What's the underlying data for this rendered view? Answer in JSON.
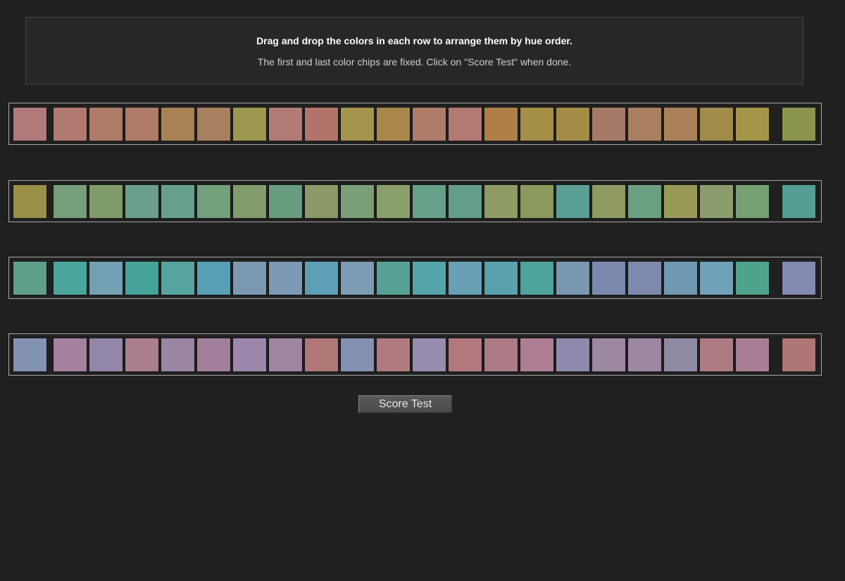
{
  "instructions": {
    "title": "Drag and drop the colors in each row to arrange them by hue order.",
    "subtitle": "The first and last color chips are fixed. Click on \"Score Test\" when done."
  },
  "score_button_label": "Score Test",
  "rows": [
    {
      "fixed_start": "#b17a7a",
      "movable": [
        "#b17a70",
        "#ae7b66",
        "#ae7c66",
        "#a98253",
        "#a8805f",
        "#9e974f",
        "#b17a75",
        "#b2746a",
        "#a4954d",
        "#a9874a",
        "#ae7c68",
        "#b17a73",
        "#ae8047",
        "#a38f46",
        "#a58c46",
        "#a67a6b",
        "#aa7f60",
        "#aa805a",
        "#a18b4a",
        "#a49649"
      ],
      "fixed_end": "#8b944c"
    },
    {
      "fixed_start": "#998f47",
      "movable": [
        "#769e79",
        "#7f9b6a",
        "#6aa08b",
        "#66a08b",
        "#71a07b",
        "#819b6a",
        "#679d7e",
        "#8a9966",
        "#7a9f77",
        "#8a9f6a",
        "#65a089",
        "#639e89",
        "#8e9b64",
        "#8b9a5c",
        "#5a9f94",
        "#8e9a62",
        "#6a9f82",
        "#999a57",
        "#8d9c6c",
        "#769f72"
      ],
      "fixed_end": "#559e93"
    },
    {
      "fixed_start": "#5e9f8c",
      "movable": [
        "#4aa59d",
        "#74a0b4",
        "#46a39a",
        "#56a49f",
        "#57a0b5",
        "#7b99b2",
        "#7c9ab6",
        "#5e9fb5",
        "#7b9cb3",
        "#55a295",
        "#55a4aa",
        "#66a0b2",
        "#5aa1ae",
        "#4ea39c",
        "#7997b1",
        "#7a89ad",
        "#7f89ab",
        "#6f99b2",
        "#6fa1b8",
        "#4ea38d"
      ],
      "fixed_end": "#848ab1"
    },
    {
      "fixed_start": "#8492b4",
      "movable": [
        "#a6819f",
        "#9387a9",
        "#ab7e8e",
        "#9a85a3",
        "#a27f9a",
        "#9d88ad",
        "#a085a3",
        "#af7776",
        "#8591b2",
        "#b07b80",
        "#968dae",
        "#b1797f",
        "#ad7b88",
        "#ad7e92",
        "#8d8aae",
        "#9d88a2",
        "#9d87a3",
        "#8e8aa4",
        "#ae7b84",
        "#a97e95"
      ],
      "fixed_end": "#ae7775"
    }
  ]
}
